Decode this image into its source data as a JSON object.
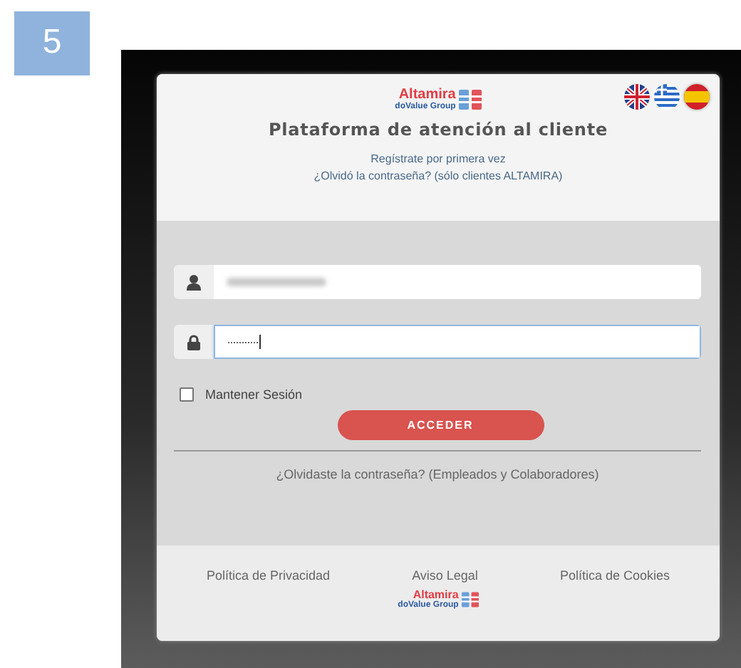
{
  "step": "5",
  "header": {
    "logo": {
      "name": "Altamira",
      "tagline": "doValue Group"
    },
    "languages": [
      {
        "kind": "uk",
        "selected": false
      },
      {
        "kind": "greece",
        "selected": false
      },
      {
        "kind": "spain",
        "selected": true
      }
    ],
    "title": "Plataforma de atención al cliente",
    "links": [
      "Regístrate por primera vez",
      "¿Olvidó la contraseña? (sólo clientes ALTAMIRA)"
    ]
  },
  "form": {
    "username": {
      "kind": "user",
      "focused": false,
      "value_hidden": true
    },
    "password": {
      "kind": "lock",
      "focused": true,
      "value": "···········"
    },
    "remember": {
      "label": "Mantener Sesión",
      "checked": false
    },
    "submit": "ACCEDER",
    "forgot": "¿Olvidaste la contraseña? (Empleados y Colaboradores)"
  },
  "footer": {
    "links": [
      "Política de Privacidad",
      "Aviso Legal",
      "Política de Cookies"
    ],
    "logo": {
      "name": "Altamira",
      "tagline": "doValue Group"
    }
  }
}
